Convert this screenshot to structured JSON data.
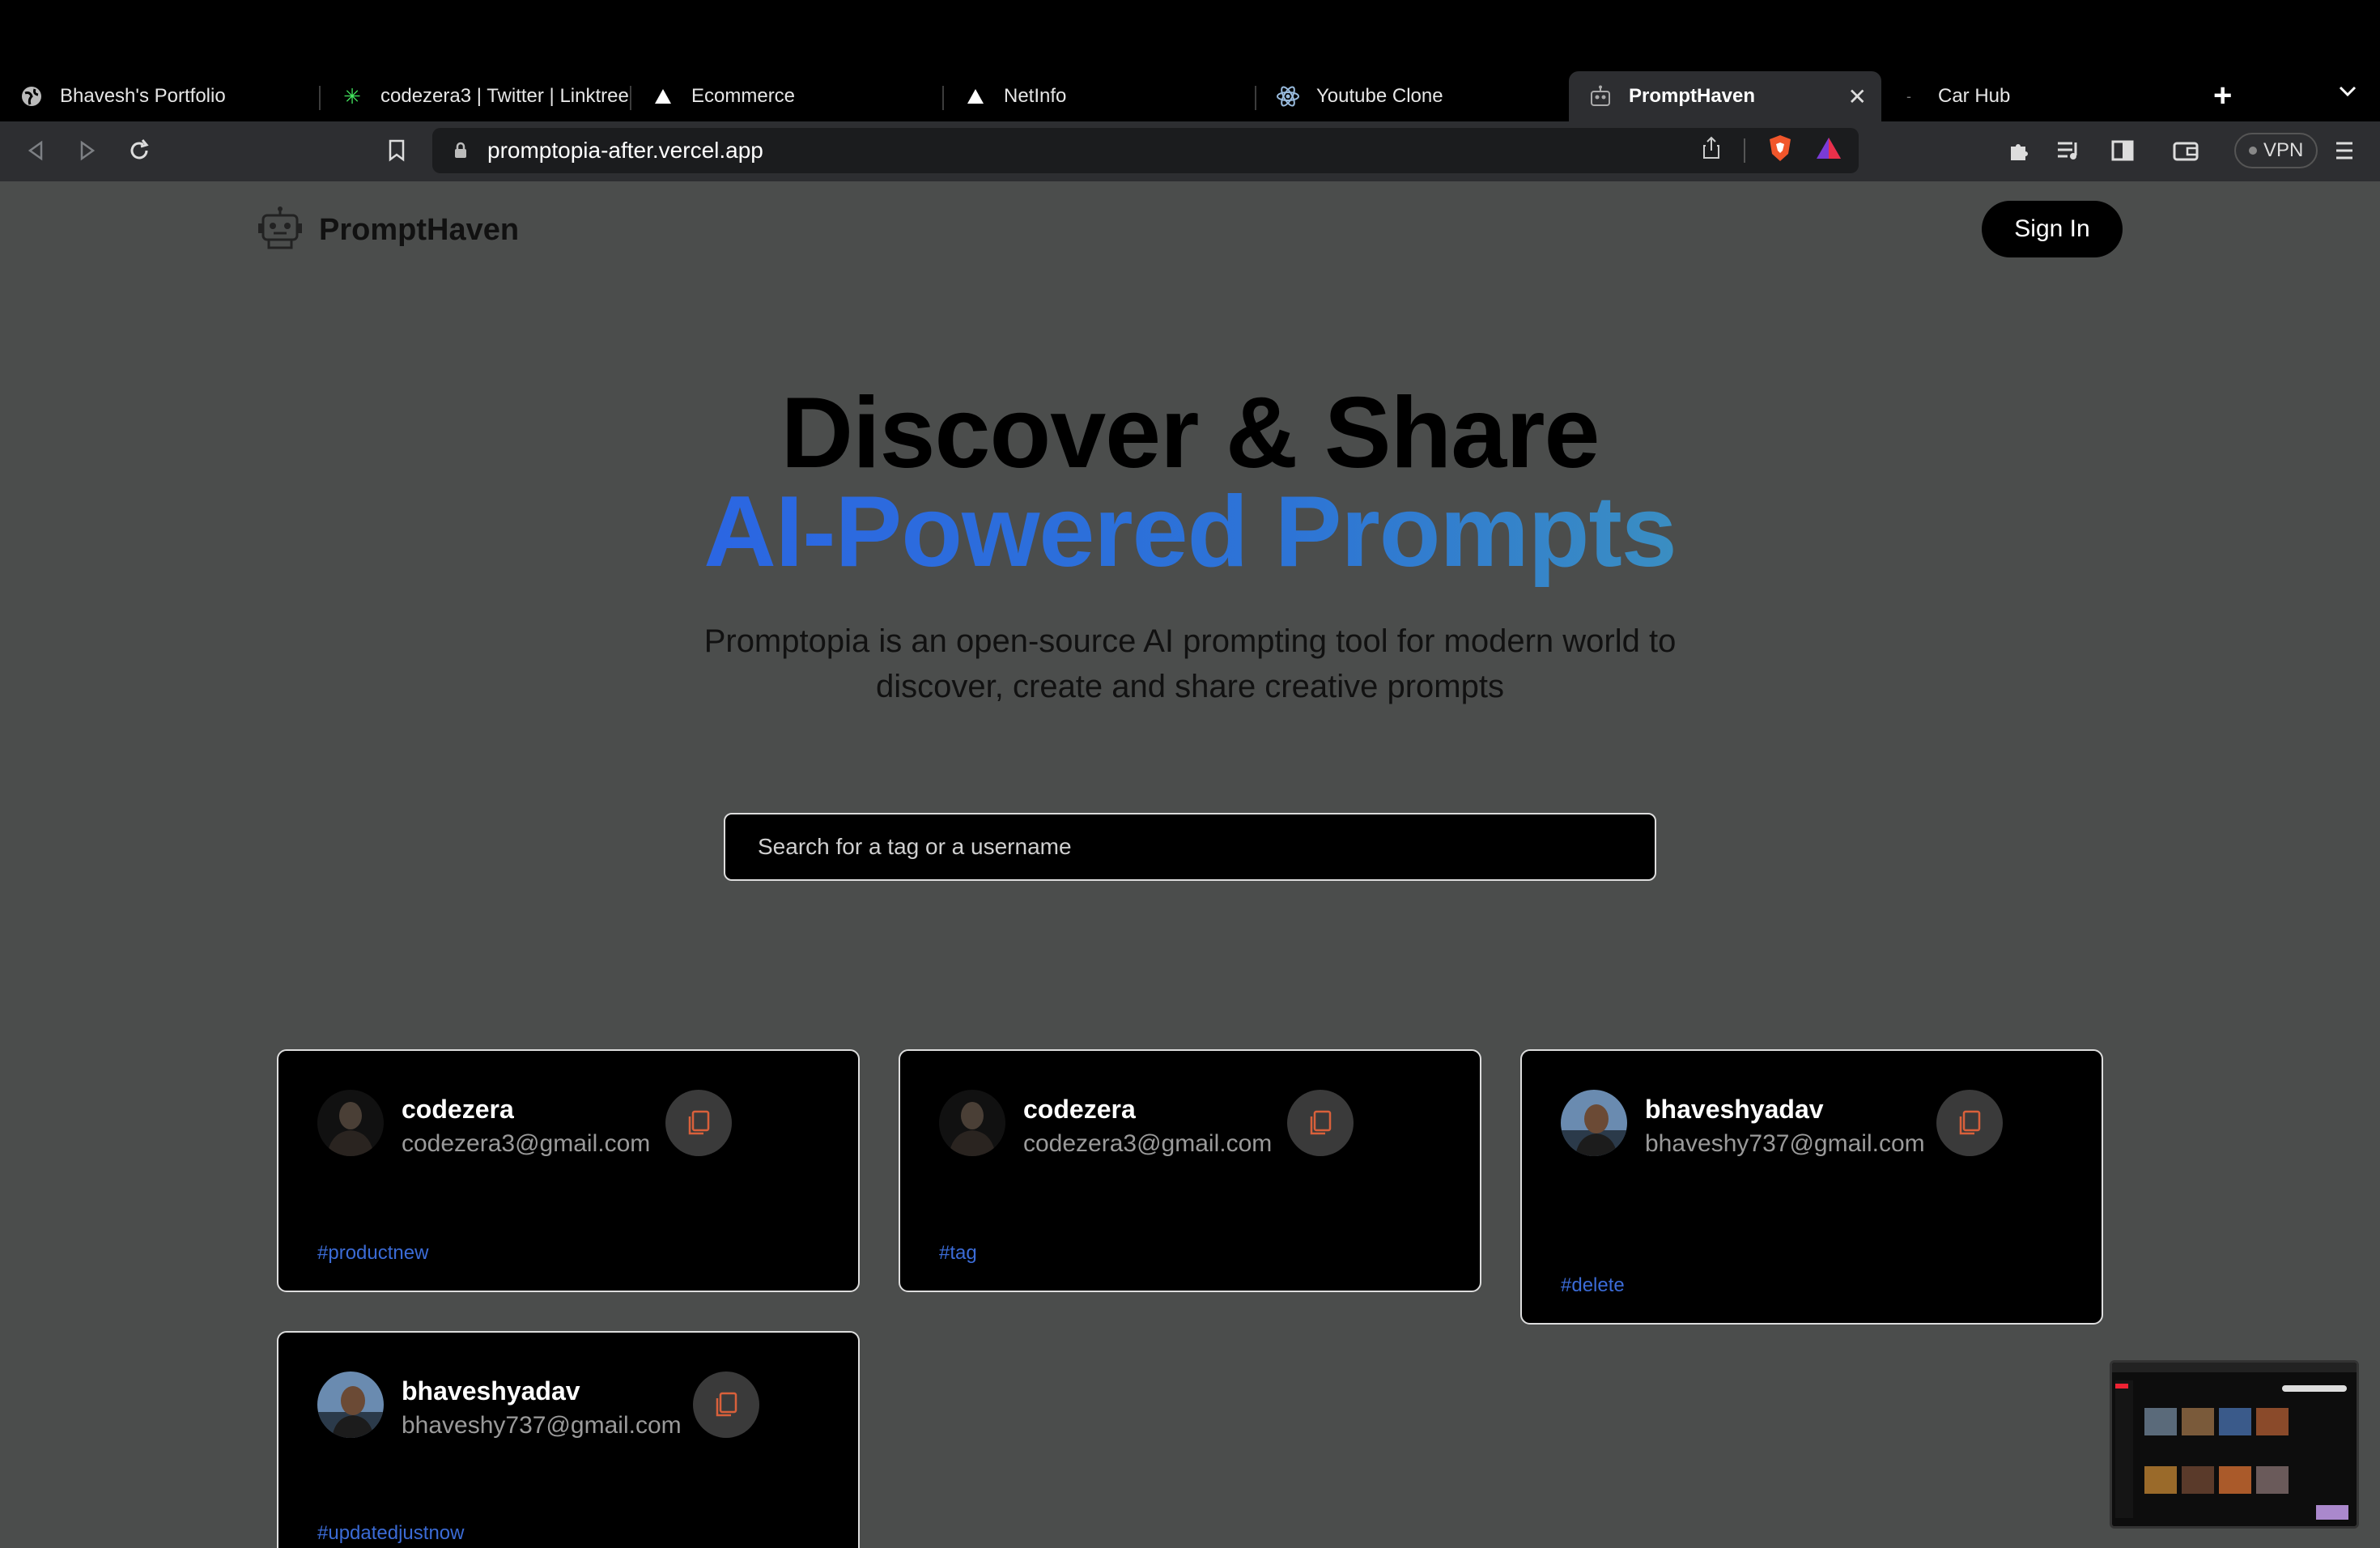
{
  "browser": {
    "tabs": [
      {
        "title": "Bhavesh's Portfolio",
        "icon": "globe-icon"
      },
      {
        "title": "codezera3 | Twitter | Linktree",
        "icon": "linktree-icon"
      },
      {
        "title": "Ecommerce",
        "icon": "vercel-icon"
      },
      {
        "title": "NetInfo",
        "icon": "vercel-icon"
      },
      {
        "title": "Youtube Clone",
        "icon": "react-icon"
      },
      {
        "title": "PromptHaven",
        "icon": "robot-icon",
        "active": true
      },
      {
        "title": "Car Hub",
        "icon": "dash-icon"
      }
    ],
    "url": "promptopia-after.vercel.app",
    "vpn_label": "VPN"
  },
  "site": {
    "logo_text": "PromptHaven",
    "signin_label": "Sign In"
  },
  "hero": {
    "title_line1": "Discover & Share",
    "title_line2": "AI-Powered Prompts",
    "description": "Promptopia is an open-source AI prompting tool for modern world to discover, create and share creative prompts"
  },
  "search": {
    "placeholder": "Search for a tag or a username"
  },
  "prompts": [
    {
      "username": "codezera",
      "email": "codezera3@gmail.com",
      "tag": "#productnew"
    },
    {
      "username": "codezera",
      "email": "codezera3@gmail.com",
      "tag": "#tag"
    },
    {
      "username": "bhaveshyadav",
      "email": "bhaveshy737@gmail.com",
      "tag": "#delete"
    },
    {
      "username": "bhaveshyadav",
      "email": "bhaveshy737@gmail.com",
      "tag": "#updatedjustnow"
    }
  ],
  "colors": {
    "page_bg": "#4b4d4c",
    "accent_blue": "#2b66e2",
    "tag_blue": "#3b6bd6",
    "copy_icon": "#d9603b"
  }
}
